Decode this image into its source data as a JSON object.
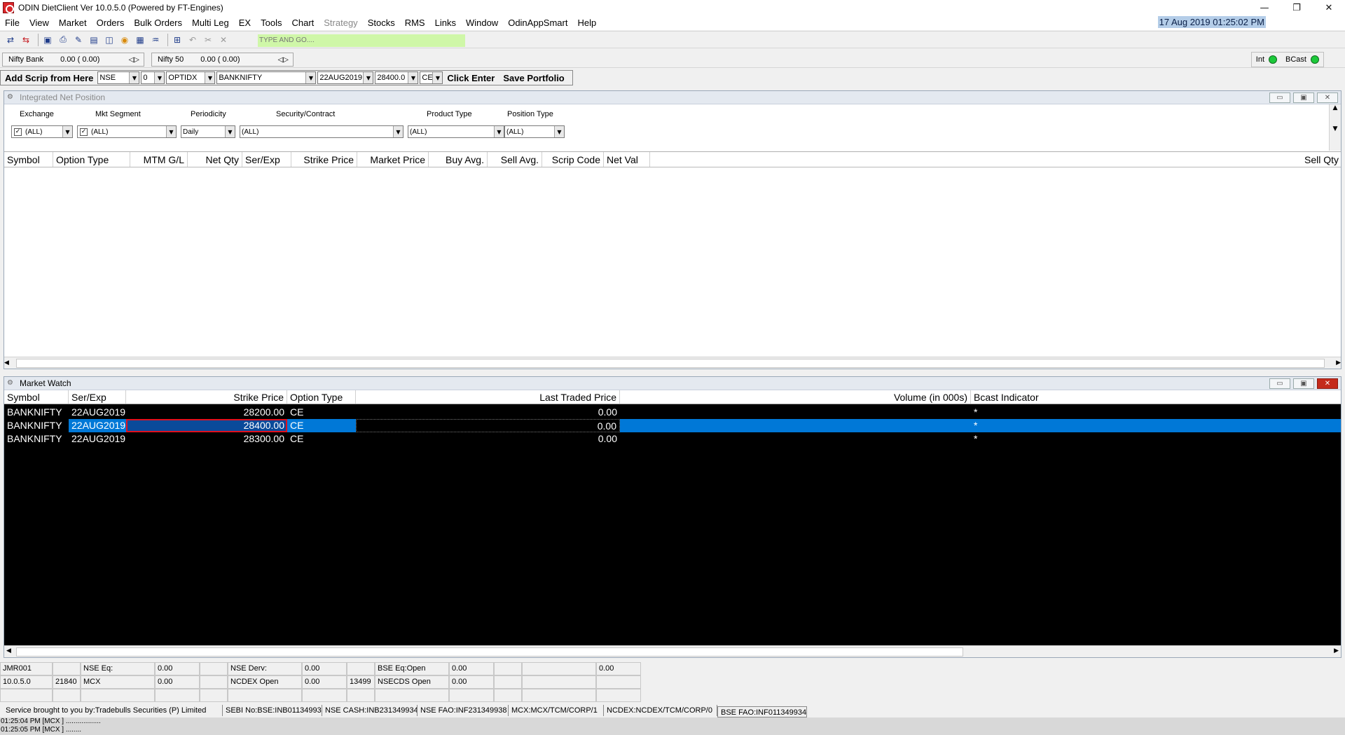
{
  "window": {
    "title": "ODIN DietClient Ver 10.0.5.0 (Powered by FT-Engines)",
    "controls": [
      "—",
      "❐",
      "✕"
    ]
  },
  "menu": [
    "File",
    "View",
    "Market",
    "Orders",
    "Bulk Orders",
    "Multi Leg",
    "EX",
    "Tools",
    "Chart",
    "Strategy",
    "Stocks",
    "RMS",
    "Links",
    "Window",
    "OdinAppSmart",
    "Help"
  ],
  "datetime": "17 Aug 2019  01:25:02 PM",
  "toolbar": {
    "search_placeholder": "TYPE AND GO....",
    "icons": [
      "buy-icon",
      "sell-icon",
      "save-icon",
      "print-icon",
      "edit-icon",
      "market-watch-icon",
      "chart-icon",
      "quote-icon",
      "calc-icon",
      "settings-icon",
      "undo-icon",
      "cut-icon",
      "close-icon"
    ]
  },
  "indices": [
    {
      "name": "Nifty Bank",
      "value": "0.00 ( 0.00)"
    },
    {
      "name": "Nifty 50",
      "value": "0.00 ( 0.00)"
    }
  ],
  "status_lights": {
    "int_label": "Int",
    "bcast_label": "BCast"
  },
  "scripbar": {
    "label": "Add Scrip from Here",
    "exchange": "NSE",
    "segment": "0",
    "instrument": "OPTIDX",
    "symbol": "BANKNIFTY",
    "expiry": "22AUG2019",
    "strike": "28400.0",
    "option_type": "CE",
    "click_enter": "Click Enter",
    "save_portfolio": "Save Portfolio"
  },
  "inp": {
    "title": "Integrated Net Position",
    "filters": {
      "exchange_label": "Exchange",
      "exchange_value": "(ALL)",
      "segment_label": "Mkt Segment",
      "segment_value": "(ALL)",
      "periodicity_label": "Periodicity",
      "periodicity_value": "Daily",
      "security_label": "Security/Contract",
      "security_value": "(ALL)",
      "product_label": "Product Type",
      "product_value": "(ALL)",
      "position_label": "Position Type",
      "position_value": "(ALL)"
    },
    "columns": [
      "Symbol",
      "Option Type",
      "MTM G/L",
      "Net Qty",
      "Ser/Exp",
      "Strike Price",
      "Market Price",
      "Buy Avg.",
      "Sell Avg.",
      "Scrip Code",
      "Net Val",
      "Sell Qty"
    ]
  },
  "market_watch": {
    "title": "Market Watch",
    "columns": [
      "Symbol",
      "Ser/Exp",
      "Strike Price",
      "Option Type",
      "Last Traded Price",
      "Volume (in 000s)",
      "Bcast Indicator"
    ],
    "rows": [
      {
        "symbol": "BANKNIFTY",
        "ser_exp": "22AUG2019",
        "strike": "28200.00",
        "opt": "CE",
        "ltp": "0.00",
        "vol": "",
        "bcast": "*"
      },
      {
        "symbol": "BANKNIFTY",
        "ser_exp": "22AUG2019",
        "strike": "28400.00",
        "opt": "CE",
        "ltp": "0.00",
        "vol": "",
        "bcast": "*"
      },
      {
        "symbol": "BANKNIFTY",
        "ser_exp": "22AUG2019",
        "strike": "28300.00",
        "opt": "CE",
        "ltp": "0.00",
        "vol": "",
        "bcast": "*"
      }
    ]
  },
  "statusgrid": {
    "r1": [
      "JMR001",
      "",
      "NSE Eq:",
      "0.00",
      "",
      "NSE Derv:",
      "0.00",
      "",
      "BSE Eq:Open",
      "0.00",
      "",
      "",
      "0.00",
      ""
    ],
    "r2": [
      "10.0.5.0",
      "21840",
      "MCX",
      "0.00",
      "",
      "NCDEX Open",
      "0.00",
      "13499",
      "NSECDS Open",
      "0.00",
      "",
      "",
      "",
      ""
    ]
  },
  "infobar": [
    "Service brought to you by:Tradebulls Securities (P) Limited",
    "SEBI No:BSE:INB011349934",
    "NSE CASH:INB231349934",
    "NSE FAO:INF231349938",
    "MCX:MCX/TCM/CORP/1",
    "NCDEX:NCDEX/TCM/CORP/0",
    "BSE FAO:INF011349934"
  ],
  "log": [
    "01:25:04 PM [MCX ] ..................",
    "01:25:05 PM [MCX ] ........"
  ]
}
